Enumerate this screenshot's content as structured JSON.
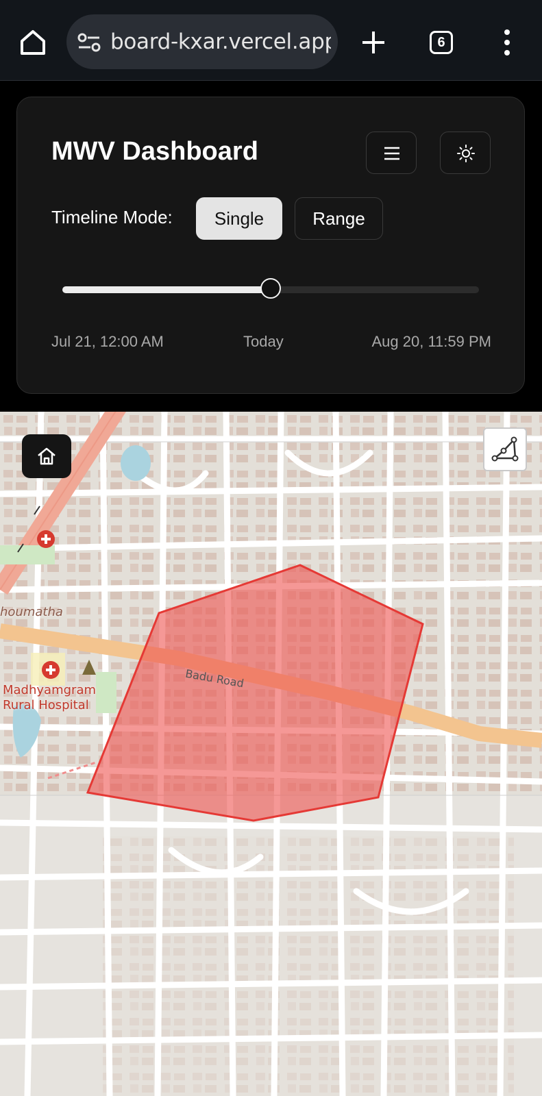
{
  "browser": {
    "url": "board-kxar.vercel.app",
    "tab_count": "6"
  },
  "header": {
    "title": "MWV Dashboard"
  },
  "timeline": {
    "mode_label": "Timeline Mode:",
    "modes": [
      "Single",
      "Range"
    ],
    "selected_mode": "Single",
    "slider_fraction": 0.5,
    "start_label": "Jul 21, 12:00 AM",
    "current_label": "Today",
    "end_label": "Aug 20, 11:59 PM"
  },
  "map": {
    "road_label": "Badu Road",
    "place_label_line1": "Madhyamgram",
    "place_label_line2": "Rural Hospital",
    "area_label": "houmatha",
    "polygon_fill": "#ef5350",
    "polygon_stroke": "#e53935"
  },
  "colors": {
    "accent": "#e4e4e4",
    "card_bg": "#161616",
    "map_bg": "#ebe8e3"
  }
}
